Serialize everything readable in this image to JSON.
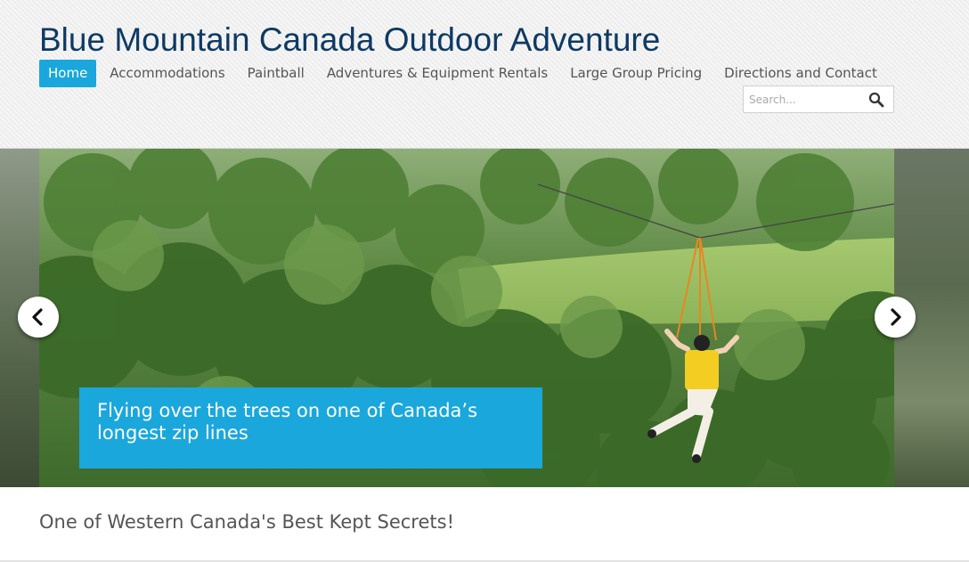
{
  "site": {
    "title": "Blue Mountain Canada Outdoor Adventure"
  },
  "nav": {
    "items": [
      {
        "label": "Home",
        "active": true
      },
      {
        "label": "Accommodations",
        "active": false
      },
      {
        "label": "Paintball",
        "active": false
      },
      {
        "label": "Adventures & Equipment Rentals",
        "active": false
      },
      {
        "label": "Large Group Pricing",
        "active": false
      },
      {
        "label": "Directions and Contact",
        "active": false
      }
    ]
  },
  "search": {
    "placeholder": "Search...",
    "value": "",
    "icon": "search-icon"
  },
  "slider": {
    "caption": "Flying over the trees on one of Canada’s longest zip lines",
    "prev_icon": "chevron-left-icon",
    "next_icon": "chevron-right-icon"
  },
  "main": {
    "tagline": "One of Western Canada's Best Kept Secrets!"
  },
  "colors": {
    "accent": "#1aa7dc",
    "title": "#0e3a63",
    "text": "#555555"
  }
}
